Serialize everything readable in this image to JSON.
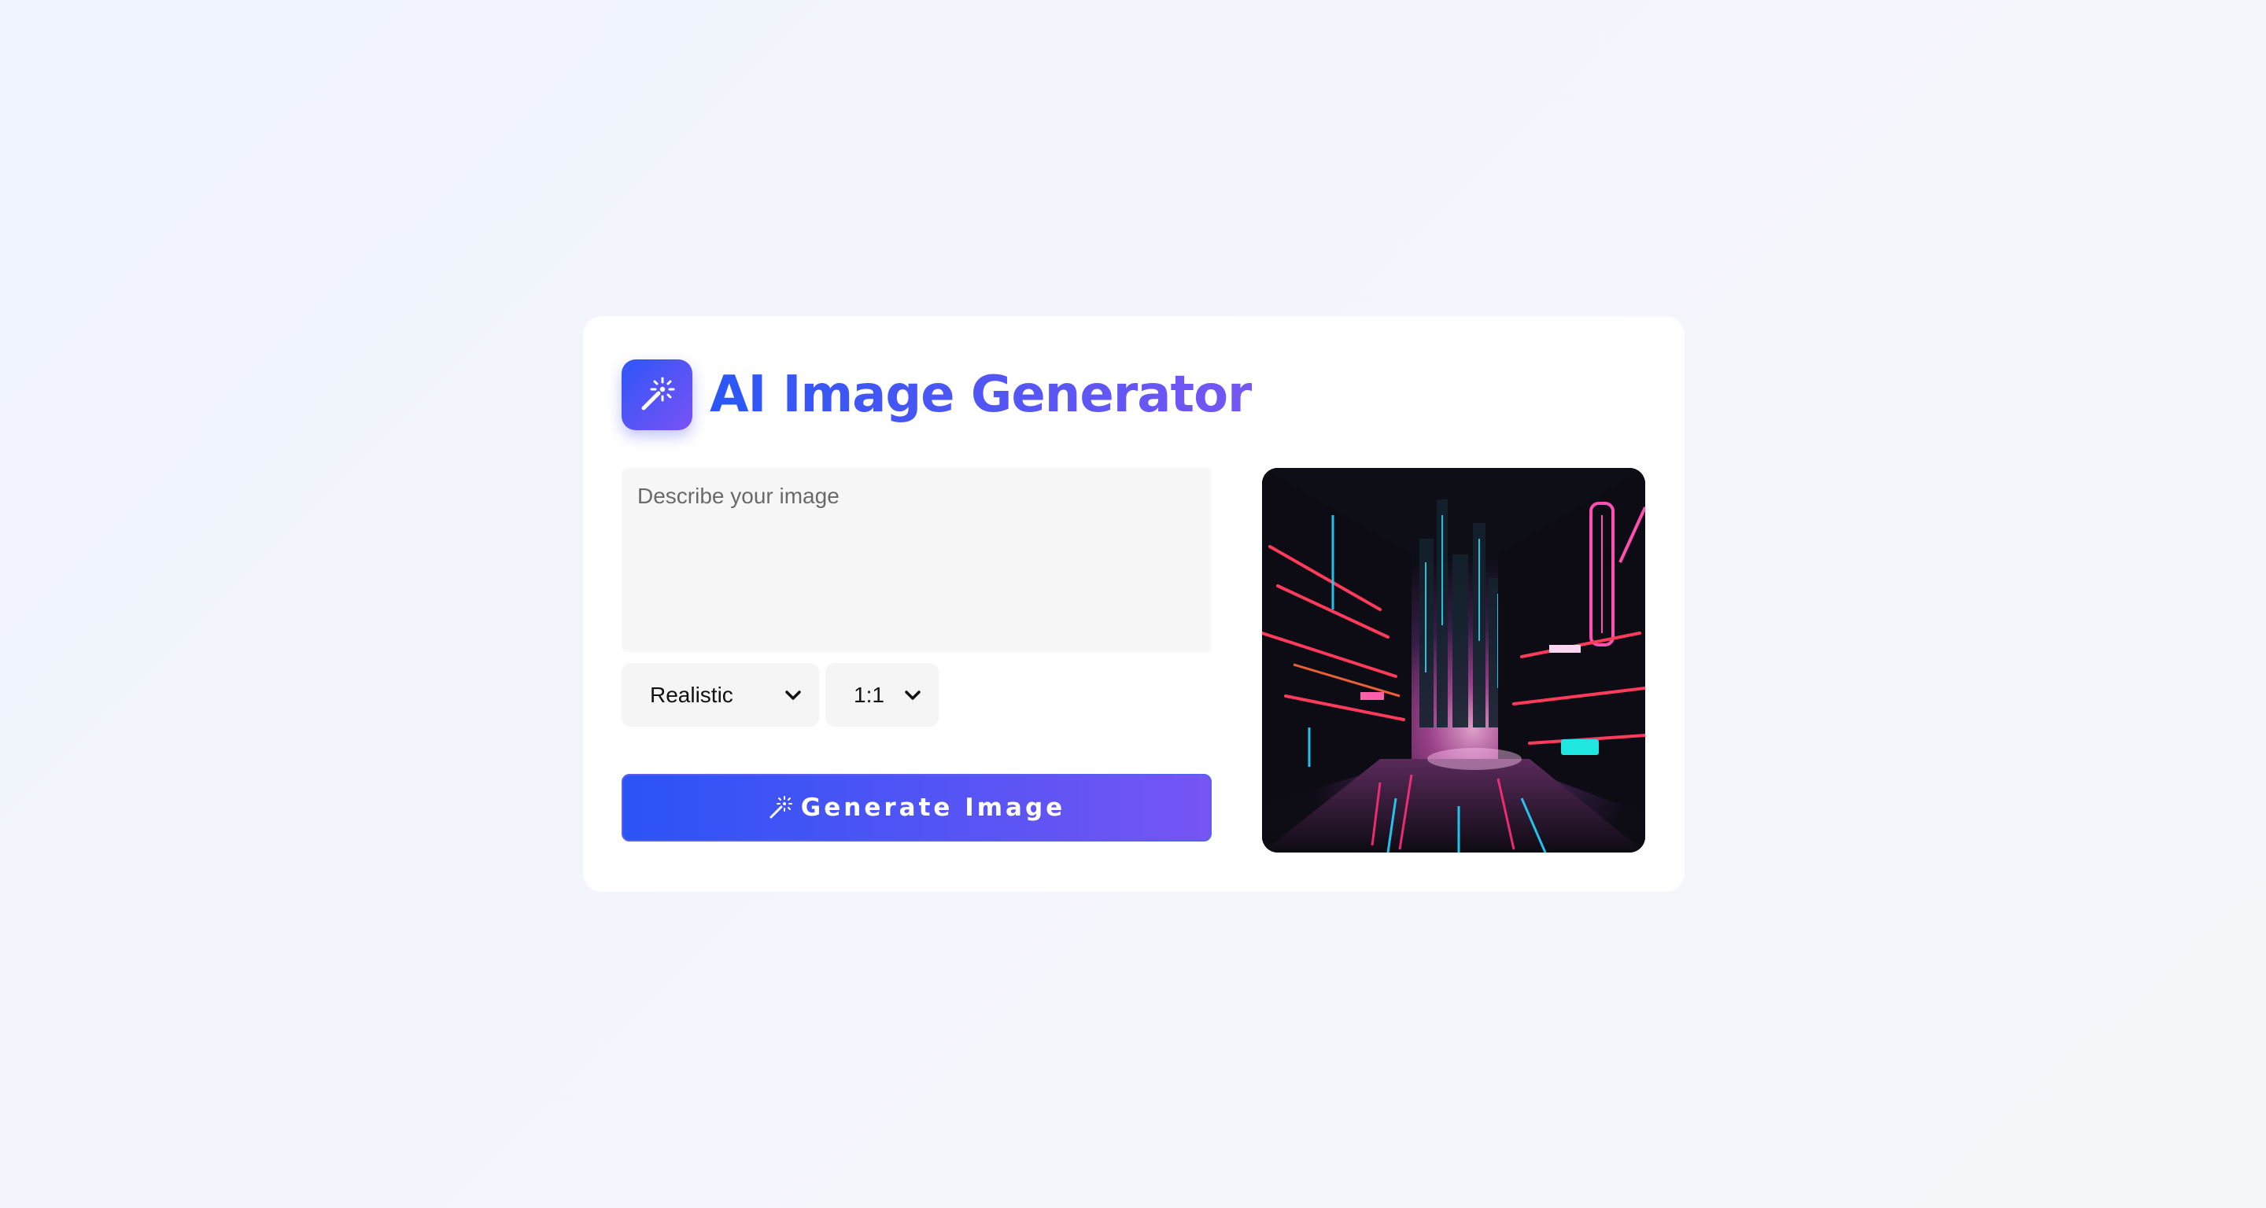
{
  "app": {
    "title": "AI Image Generator",
    "logo_icon": "magic-wand-icon"
  },
  "form": {
    "prompt_placeholder": "Describe your image",
    "prompt_value": "",
    "style_select": {
      "selected": "Realistic"
    },
    "ratio_select": {
      "selected": "1:1"
    },
    "generate_label": "Generate Image",
    "generate_icon": "magic-wand-icon"
  },
  "preview": {
    "image_icon": "generated-image"
  },
  "colors": {
    "accent_start": "#2b53f6",
    "accent_end": "#7655f4",
    "background": "#f3f5fb"
  }
}
